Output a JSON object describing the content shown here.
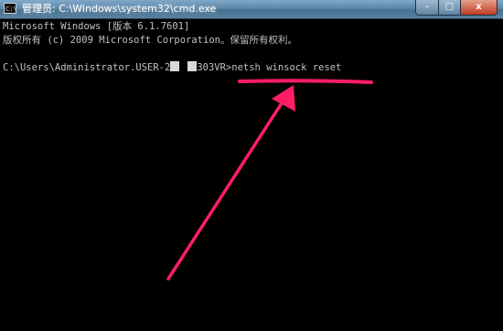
{
  "window": {
    "title": "管理员: C:\\Windows\\system32\\cmd.exe",
    "icon": "cmd-icon",
    "controls": {
      "minimize": "–",
      "maximize": "□",
      "close": "x"
    }
  },
  "console": {
    "lines": [
      "Microsoft Windows [版本 6.1.7601]",
      "版权所有 (c) 2009 Microsoft Corporation。保留所有权利。"
    ],
    "prompt_prefix": "C:\\Users\\Administrator.USER-2",
    "prompt_suffix": "303VR>",
    "command": "netsh winsock reset"
  },
  "annotation": {
    "color": "#ff1e63",
    "icon": "arrow-annotation"
  }
}
